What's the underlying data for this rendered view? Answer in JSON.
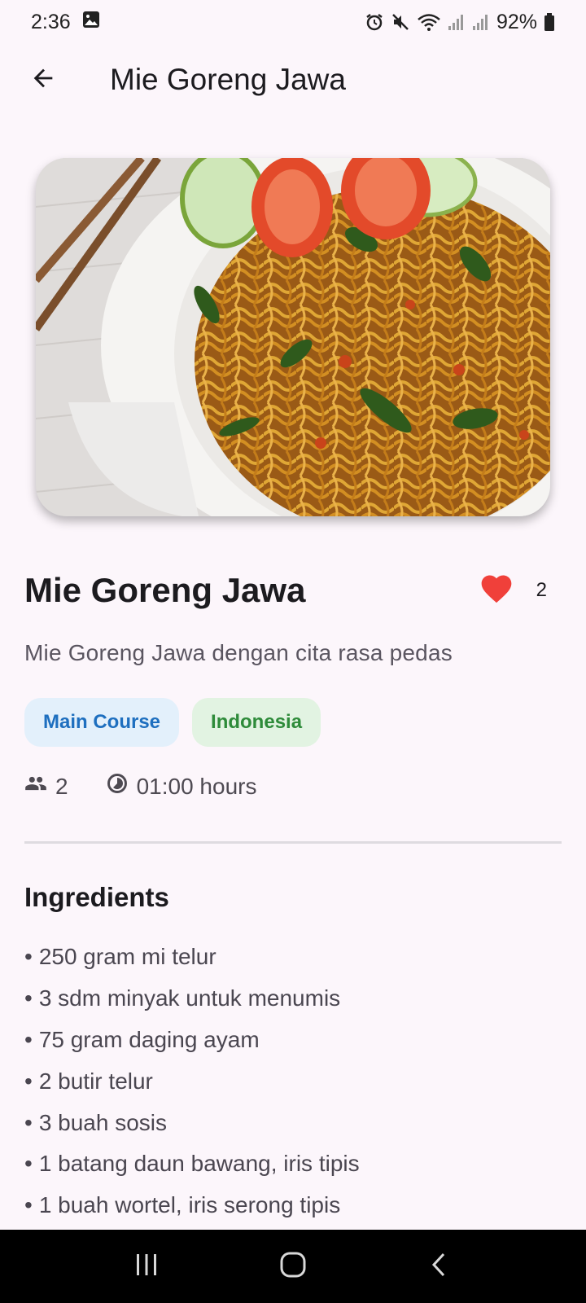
{
  "status_bar": {
    "time": "2:36",
    "battery": "92%"
  },
  "app_bar": {
    "title": "Mie Goreng Jawa"
  },
  "recipe": {
    "name": "Mie Goreng Jawa",
    "likes": "2",
    "description": "Mie Goreng Jawa dengan cita rasa pedas",
    "category": "Main Course",
    "area": "Indonesia",
    "servings": "2",
    "duration": "01:00 hours"
  },
  "ingredients_section": {
    "title": "Ingredients",
    "items": [
      "250 gram mi telur",
      "3 sdm minyak untuk menumis",
      "75 gram daging ayam",
      "2 butir telur",
      "3 buah sosis",
      "1 batang daun bawang, iris tipis",
      "1 buah wortel, iris serong tipis"
    ]
  },
  "colors": {
    "background": "#fcf6fb",
    "heart": "#f0403a",
    "category_chip_bg": "#e3f0fb",
    "category_chip_text": "#1e6fbf",
    "area_chip_bg": "#e2f3e2",
    "area_chip_text": "#2e8b3a"
  },
  "icons": {
    "back": "arrow-back-icon",
    "like": "heart-icon",
    "servings": "people-icon",
    "duration": "timelapse-icon"
  }
}
